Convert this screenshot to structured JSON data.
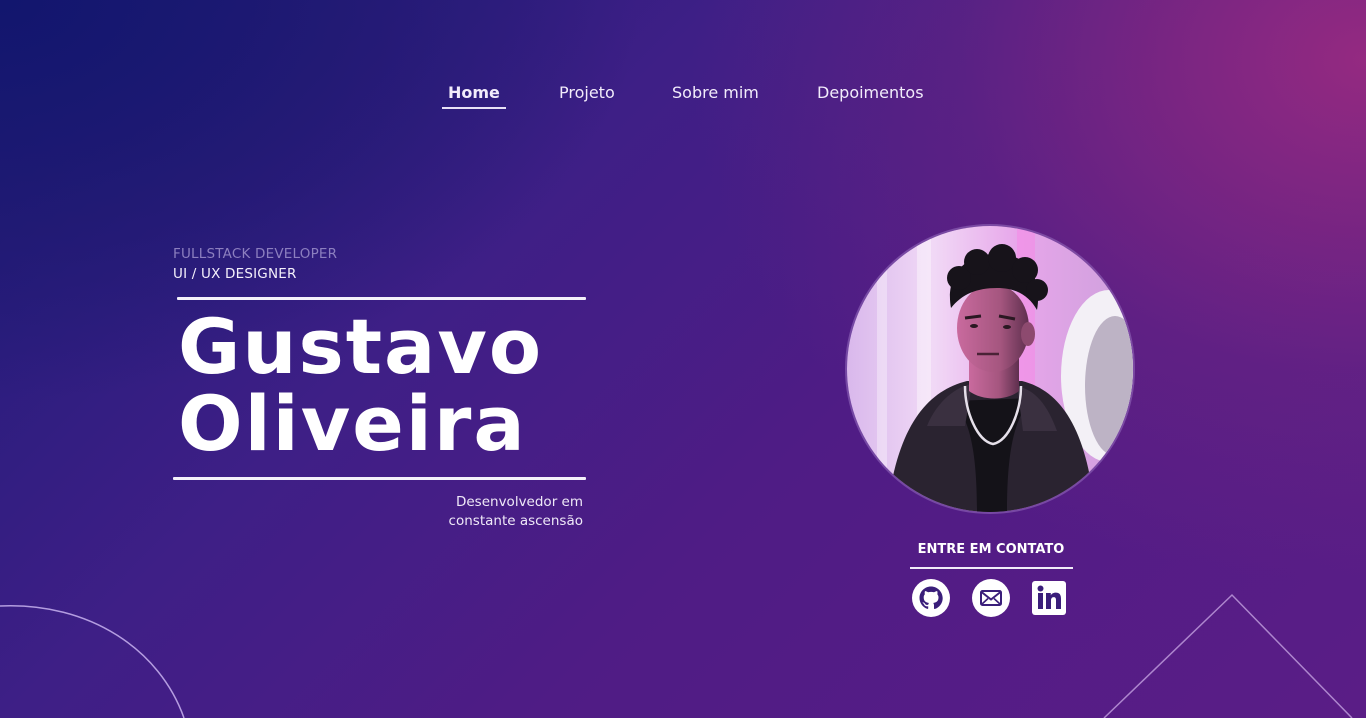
{
  "nav": {
    "items": [
      {
        "label": "Home",
        "active": true
      },
      {
        "label": "Projeto",
        "active": false
      },
      {
        "label": "Sobre mim",
        "active": false
      },
      {
        "label": "Depoimentos",
        "active": false
      }
    ]
  },
  "hero": {
    "role_primary": "FULLSTACK DEVELOPER",
    "role_secondary": "UI / UX DESIGNER",
    "first_name": "Gustavo",
    "last_name": "Oliveira",
    "tagline_line1": "Desenvolvedor em",
    "tagline_line2": "constante ascensão"
  },
  "contact": {
    "title": "ENTRE EM CONTATO",
    "links": [
      {
        "icon": "github-icon"
      },
      {
        "icon": "mail-icon"
      },
      {
        "icon": "linkedin-icon"
      }
    ]
  },
  "colors": {
    "background_start": "#1c1b78",
    "background_mid": "#4f1c85",
    "background_accent": "#a02c80",
    "text": "#ffffff",
    "muted_text": "#8c7fbf"
  }
}
